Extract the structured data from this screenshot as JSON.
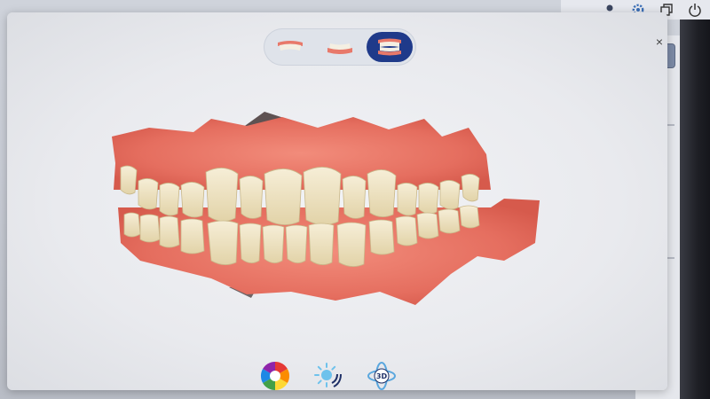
{
  "window_controls": {
    "icons": [
      "user-icon",
      "gear-icon",
      "restore-window-icon",
      "power-icon"
    ]
  },
  "modal": {
    "close_label": "×"
  },
  "view_selector": {
    "options": [
      {
        "name": "upper-jaw-view",
        "active": false
      },
      {
        "name": "lower-jaw-view",
        "active": false
      },
      {
        "name": "both-jaws-view",
        "active": true
      }
    ]
  },
  "toolbar": {
    "tools": [
      {
        "name": "color-wheel-icon"
      },
      {
        "name": "lighting-icon"
      },
      {
        "name": "3d-rotate-icon",
        "label": "3D"
      }
    ]
  },
  "colors": {
    "accent": "#1f3a8a",
    "gum": "#e8796a",
    "tooth": "#efe3c4"
  }
}
